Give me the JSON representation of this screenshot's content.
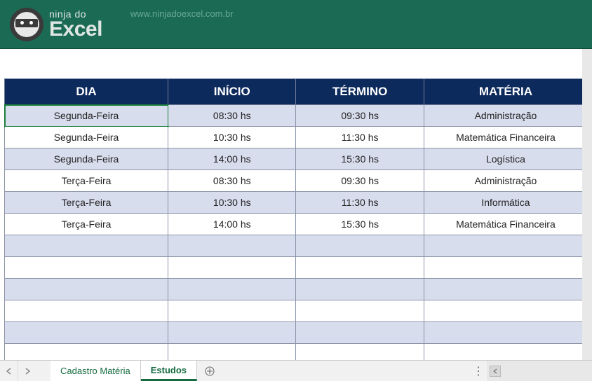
{
  "header": {
    "logo_top": "ninja do",
    "logo_bottom": "Excel",
    "url": "www.ninjadoexcel.com.br"
  },
  "table": {
    "headers": {
      "dia": "DIA",
      "inicio": "INÍCIO",
      "termino": "TÉRMINO",
      "materia": "MATÉRIA"
    },
    "rows": [
      {
        "dia": "Segunda-Feira",
        "inicio": "08:30 hs",
        "termino": "09:30 hs",
        "materia": "Administração"
      },
      {
        "dia": "Segunda-Feira",
        "inicio": "10:30 hs",
        "termino": "11:30 hs",
        "materia": "Matemática Financeira"
      },
      {
        "dia": "Segunda-Feira",
        "inicio": "14:00 hs",
        "termino": "15:30 hs",
        "materia": "Logística"
      },
      {
        "dia": "Terça-Feira",
        "inicio": "08:30 hs",
        "termino": "09:30 hs",
        "materia": "Administração"
      },
      {
        "dia": "Terça-Feira",
        "inicio": "10:30 hs",
        "termino": "11:30 hs",
        "materia": "Informática"
      },
      {
        "dia": "Terça-Feira",
        "inicio": "14:00 hs",
        "termino": "15:30 hs",
        "materia": "Matemática Financeira"
      }
    ],
    "empty_rows": 6
  },
  "tabs": {
    "tab1": "Cadastro Matéria",
    "tab2": "Estudos"
  }
}
